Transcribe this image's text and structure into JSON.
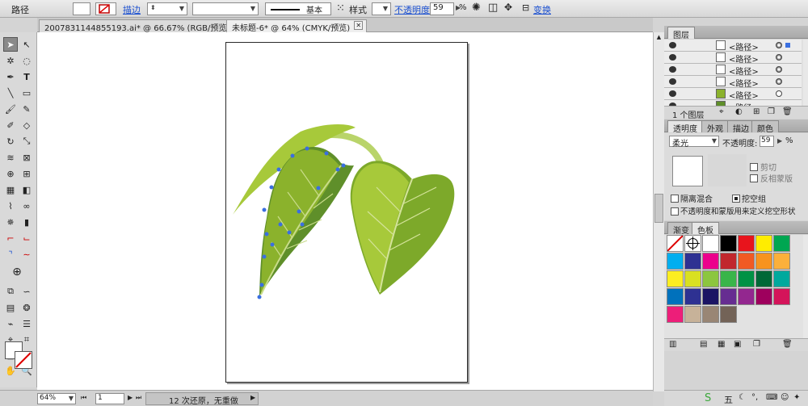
{
  "control_bar": {
    "object_label": "路径",
    "stroke_label": "描边",
    "stroke_profile": "基本",
    "style_label": "样式",
    "opacity_label": "不透明度",
    "opacity_value": "59",
    "opacity_unit": "%",
    "transform_label": "变换"
  },
  "tabs": [
    {
      "title": "2007831144855193.ai* @ 66.67% (RGB/预览)"
    },
    {
      "title": "未标题-6* @ 64% (CMYK/预览)"
    }
  ],
  "status": {
    "zoom": "64%",
    "artboard": "1",
    "undo_text": "12 次还原，无重做"
  },
  "layers_panel": {
    "title": "图层",
    "rows": [
      {
        "name": "<路径>"
      },
      {
        "name": "<路径>"
      },
      {
        "name": "<路径>"
      },
      {
        "name": "<路径>"
      },
      {
        "name": "<路径>"
      },
      {
        "name": "<路径>"
      }
    ],
    "footer": "1 个图层"
  },
  "transparency_panel": {
    "tabs": [
      "透明度",
      "外观",
      "描边",
      "颜色"
    ],
    "blend_mode": "柔光",
    "opacity_label": "不透明度:",
    "opacity_value": "59",
    "clip_label": "剪切",
    "invert_label": "反相蒙版",
    "isolate_label": "隔离混合",
    "knockout_label": "挖空组",
    "opacity_mask_label": "不透明度和蒙版用来定义挖空形状"
  },
  "swatches_panel": {
    "tabs": [
      "渐变",
      "色板"
    ],
    "colors": [
      "#ffffff",
      "#000000",
      "#e8141c",
      "#ffed00",
      "#00a651",
      "#00aeef",
      "#2e3192",
      "#ec008c",
      "#c1272d",
      "#f15a24",
      "#f7931e",
      "#fbb03b",
      "#fcee21",
      "#d9e021",
      "#8cc63f",
      "#39b54a",
      "#009245",
      "#006837",
      "#00a99d",
      "#0071bc",
      "#2e3192",
      "#1b1464",
      "#662d91",
      "#93278f",
      "#9e005d",
      "#d4145a",
      "#ed1e79",
      "#c7b299",
      "#998675",
      "#736357"
    ]
  },
  "taskbar": {
    "ime_label": "五"
  },
  "theme": {
    "leaf_light": "#a7c93a",
    "leaf_mid": "#8bb22c",
    "leaf_dark": "#5f8f2a",
    "selection_blue": "#3a6fe0"
  }
}
